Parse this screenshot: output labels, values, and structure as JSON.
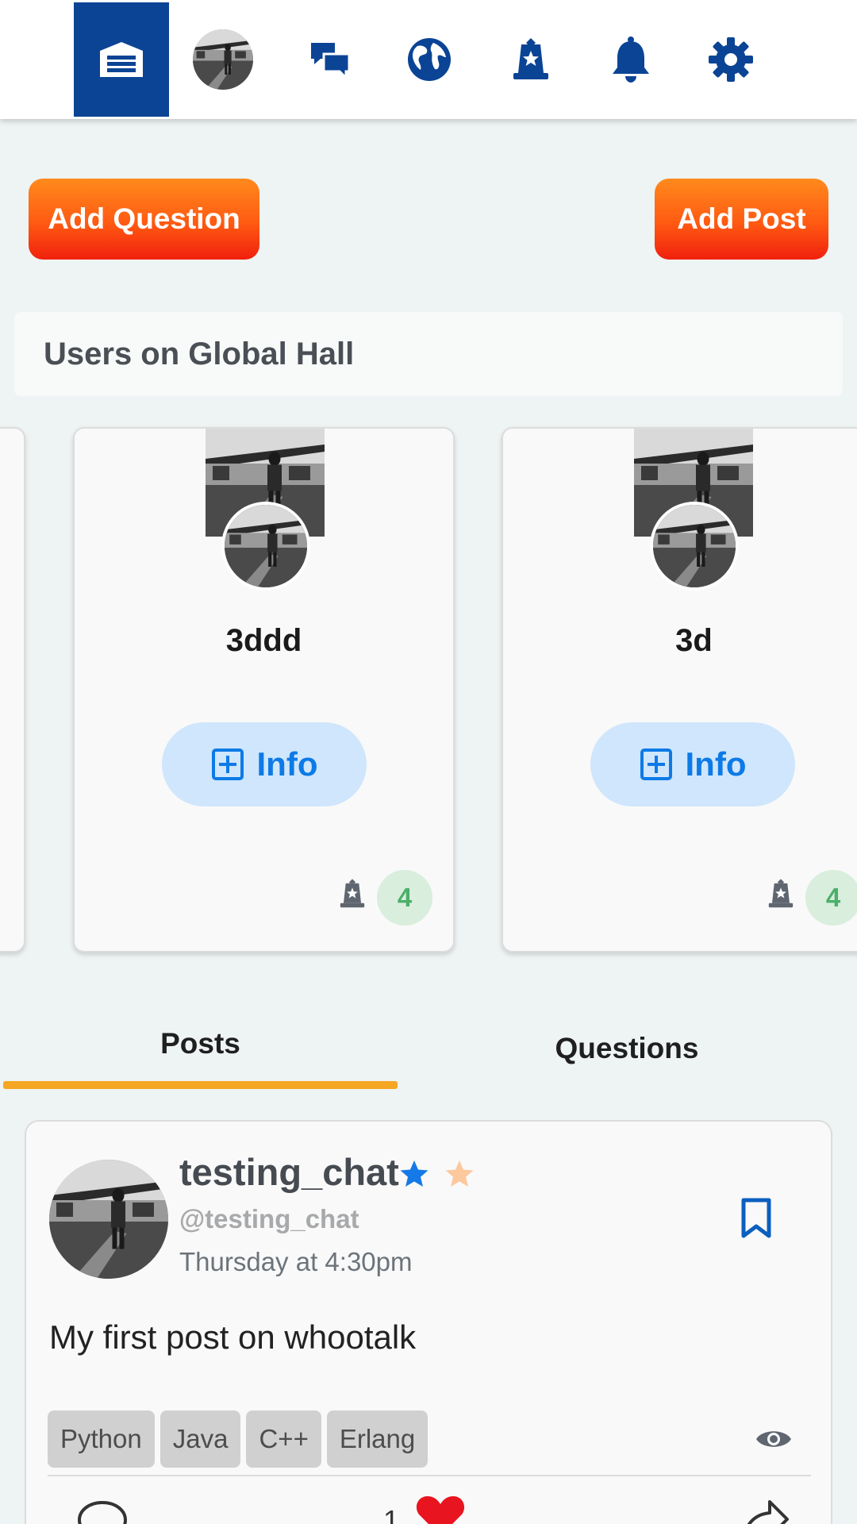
{
  "nav": {
    "items": [
      "home-icon",
      "profile-avatar",
      "chat-icon",
      "globe-icon",
      "rank-badge-icon",
      "bell-icon",
      "gear-icon"
    ],
    "accent": "#0b4495"
  },
  "actions": {
    "add_question": "Add Question",
    "add_post": "Add Post"
  },
  "users_section": {
    "title": "Users on Global Hall",
    "cards": [
      {
        "name": "3ddd",
        "info_label": "Info",
        "badge_count": "4"
      },
      {
        "name": "3d",
        "info_label": "Info",
        "badge_count": "4"
      }
    ]
  },
  "tabs": {
    "posts": "Posts",
    "questions": "Questions",
    "active": "Posts"
  },
  "post": {
    "author": "testing_chat",
    "handle": "@testing_chat",
    "time": "Thursday at 4:30pm",
    "body": "My first post on whootalk",
    "tags": [
      "Python",
      "Java",
      "C++",
      "Erlang"
    ],
    "likes": "1"
  },
  "colors": {
    "accent_orange": "#ff5a12",
    "info_blue": "#0d7ae6",
    "tab_underline": "#f5a623",
    "like_red": "#e8141f"
  }
}
